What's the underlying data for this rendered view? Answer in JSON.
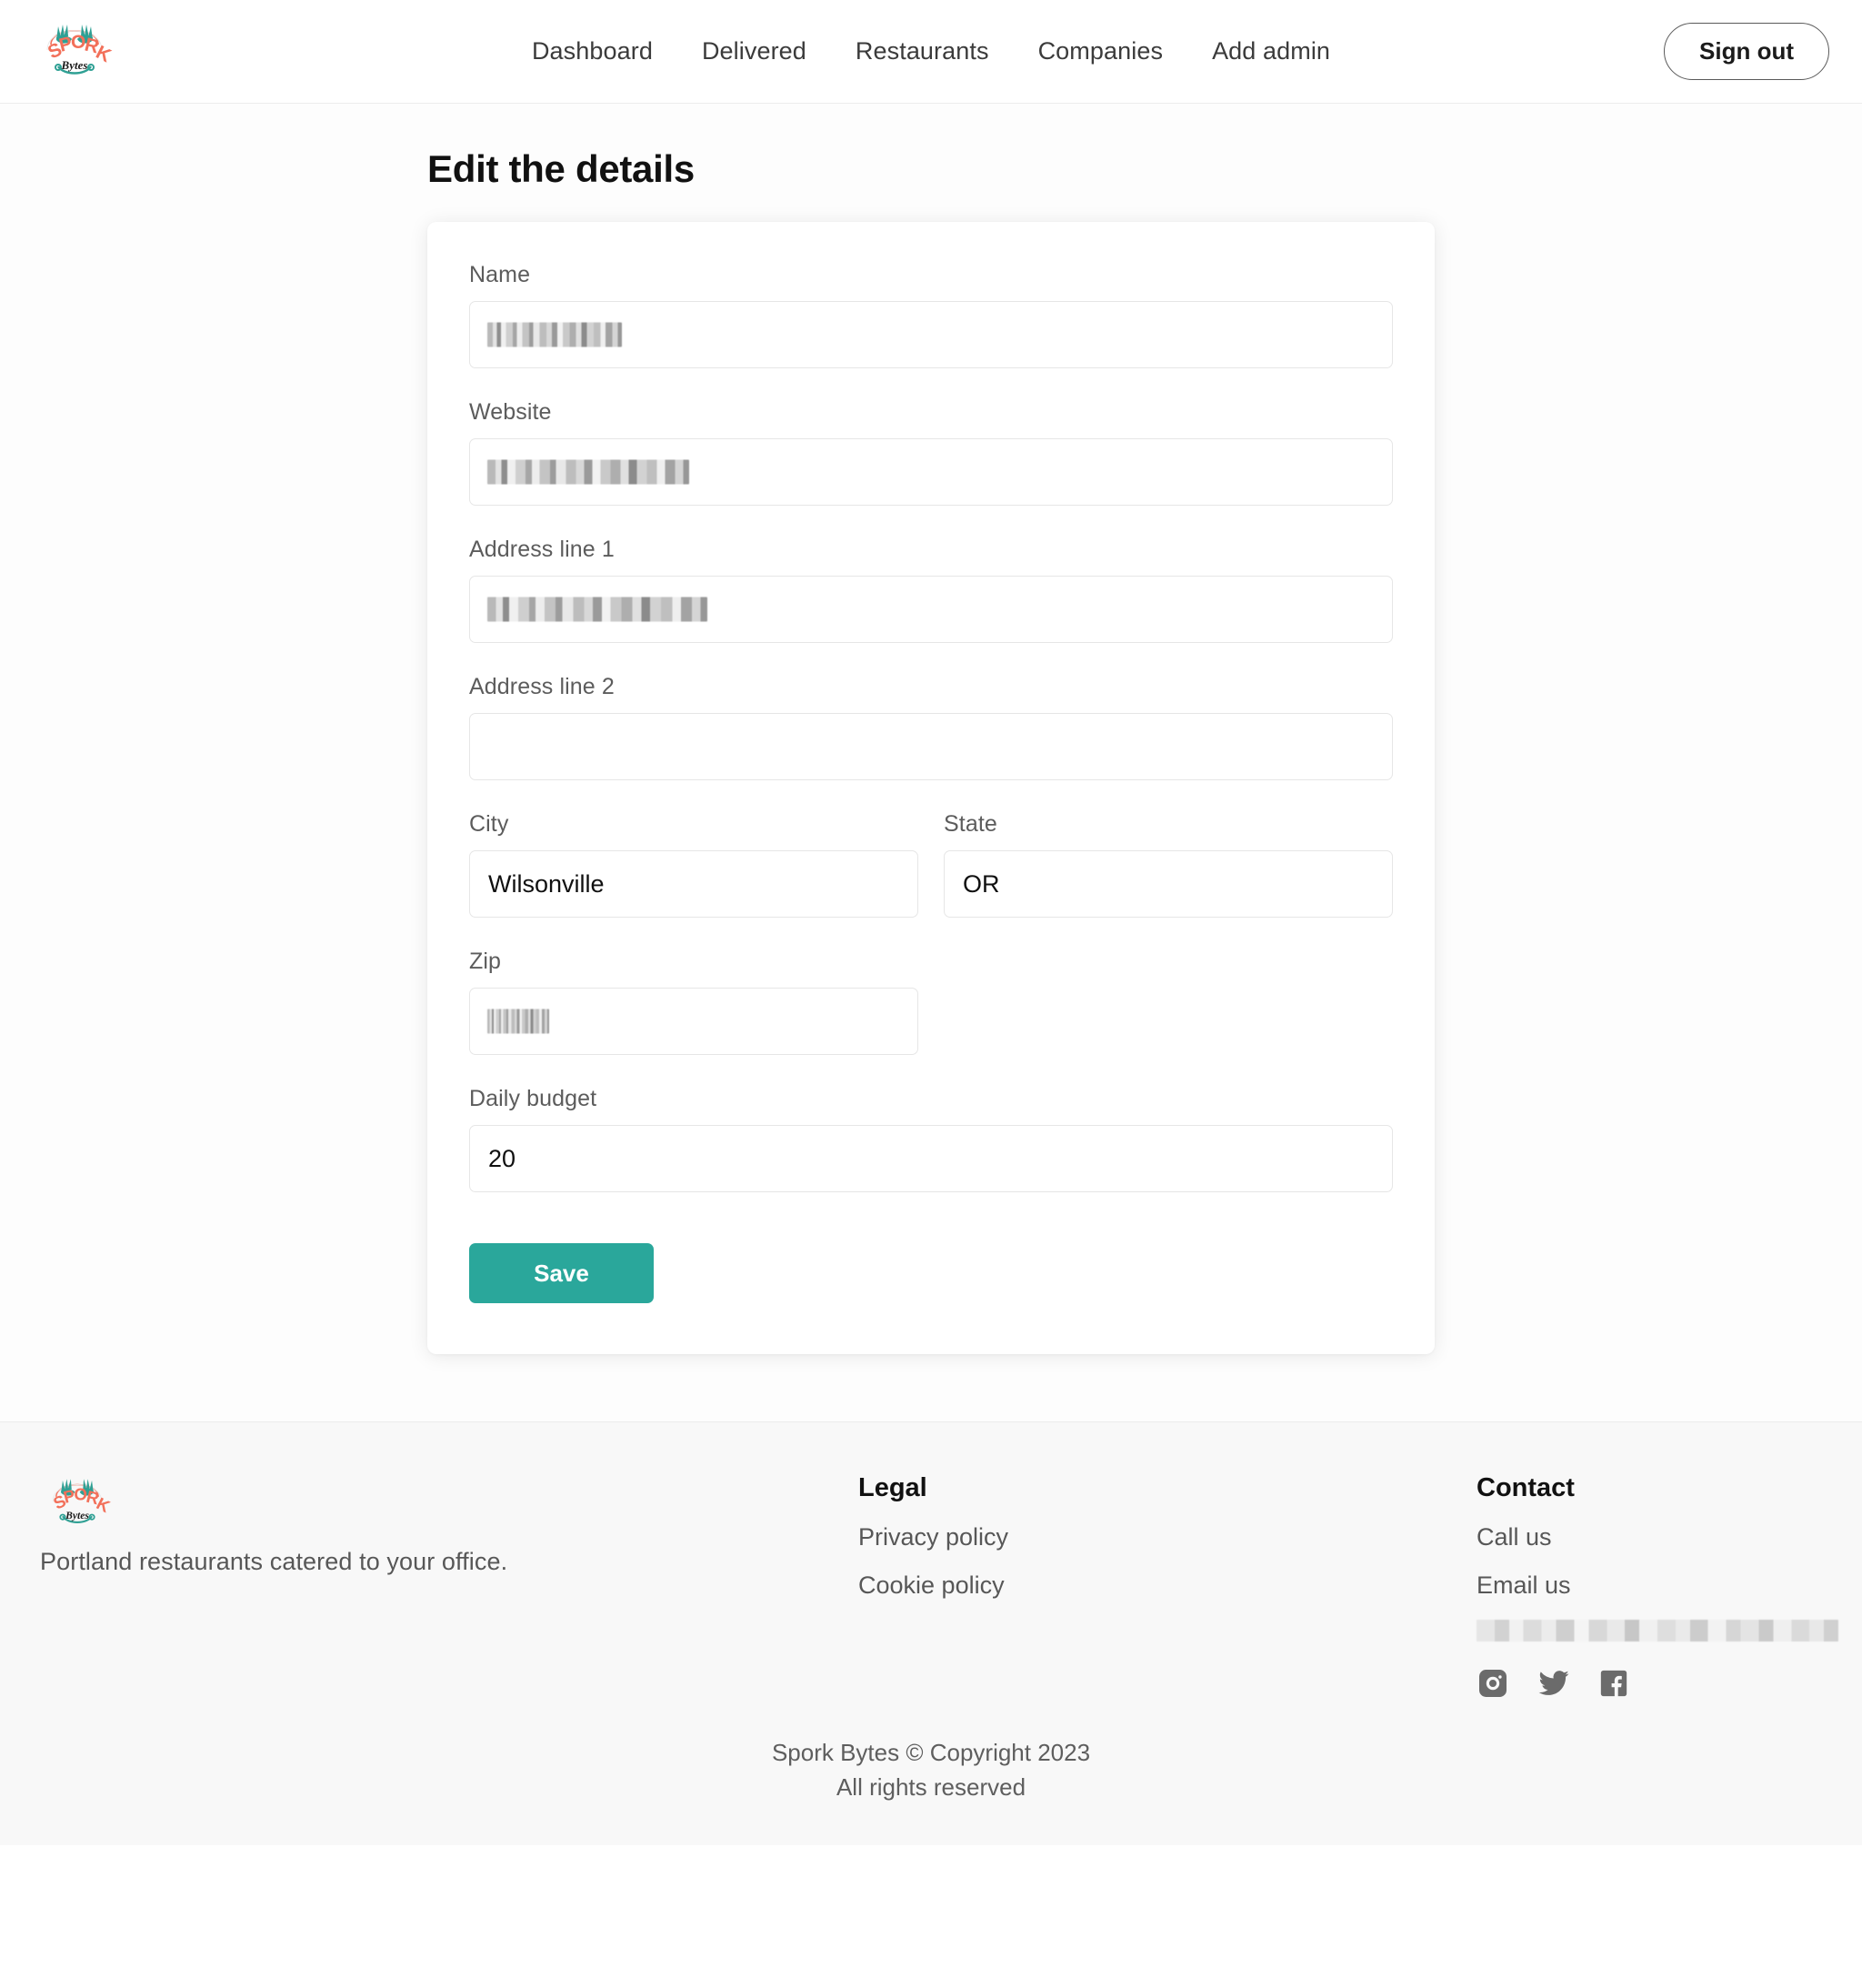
{
  "brand": {
    "name": "SPORK",
    "sub": "Bytes",
    "logo_icon": "spork-bytes-logo",
    "colors": {
      "orange": "#F2705A",
      "teal": "#2FA094",
      "accent": "#2AA79B"
    }
  },
  "nav": {
    "items": [
      {
        "label": "Dashboard",
        "name": "dashboard"
      },
      {
        "label": "Delivered",
        "name": "delivered"
      },
      {
        "label": "Restaurants",
        "name": "restaurants"
      },
      {
        "label": "Companies",
        "name": "companies"
      },
      {
        "label": "Add admin",
        "name": "add-admin"
      }
    ],
    "sign_out_label": "Sign out"
  },
  "main": {
    "page_title": "Edit the details",
    "form": {
      "name": {
        "label": "Name",
        "value": "",
        "redacted": true,
        "redacted_width": 148
      },
      "website": {
        "label": "Website",
        "value": "",
        "redacted": true,
        "redacted_width": 222
      },
      "address_line_1": {
        "label": "Address line 1",
        "value": "",
        "redacted": true,
        "redacted_width": 242
      },
      "address_line_2": {
        "label": "Address line 2",
        "value": "",
        "redacted": false
      },
      "city": {
        "label": "City",
        "value": "Wilsonville",
        "redacted": false
      },
      "state": {
        "label": "State",
        "value": "OR",
        "redacted": false
      },
      "zip": {
        "label": "Zip",
        "value": "",
        "redacted": true,
        "redacted_width": 68
      },
      "daily_budget": {
        "label": "Daily budget",
        "value": "20",
        "redacted": false
      }
    },
    "save_label": "Save"
  },
  "footer": {
    "tagline": "Portland restaurants catered to your office.",
    "legal": {
      "heading": "Legal",
      "links": [
        {
          "label": "Privacy policy",
          "name": "privacy-policy"
        },
        {
          "label": "Cookie policy",
          "name": "cookie-policy"
        }
      ]
    },
    "contact": {
      "heading": "Contact",
      "links": [
        {
          "label": "Call us",
          "name": "call-us"
        },
        {
          "label": "Email us",
          "name": "email-us"
        }
      ],
      "redacted_contact_line": true
    },
    "social": [
      {
        "name": "instagram-icon"
      },
      {
        "name": "twitter-icon"
      },
      {
        "name": "facebook-icon"
      }
    ],
    "copyright": "Spork Bytes © Copyright 2023",
    "rights": "All rights reserved"
  }
}
